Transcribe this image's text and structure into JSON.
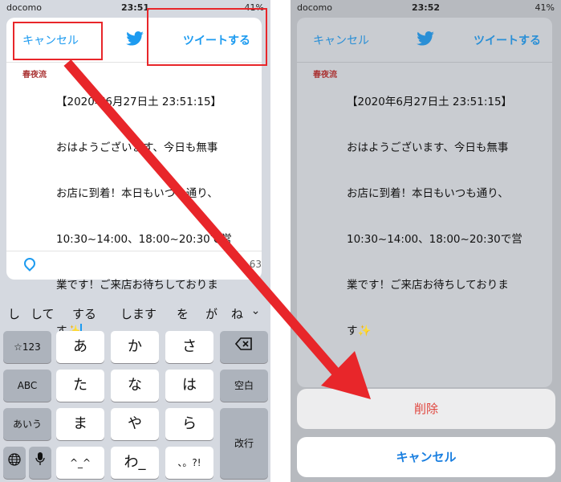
{
  "left": {
    "status": {
      "carrier": "docomo",
      "time": "23:51",
      "battery": "41%"
    },
    "header": {
      "cancel": "キャンセル",
      "tweet": "ツイートする"
    },
    "avatar_text": "春夜流",
    "tweet_lines": [
      "【2020年6月27日土 23:51:15】",
      "おはようございます、今日も無事",
      "お店に到着！本日もいつも通り、",
      "10:30~14:00、18:00~20:30で営",
      "業です！ご来店お待ちしておりま",
      "す✨"
    ],
    "char_count": "63",
    "suggestions": [
      "し",
      "して",
      "する",
      "します",
      "を",
      "が",
      "ね"
    ],
    "keys": {
      "sym": "☆123",
      "abc": "ABC",
      "aiu": "あいう",
      "a": "あ",
      "ka": "か",
      "sa": "さ",
      "ta": "た",
      "na": "な",
      "ha": "は",
      "ma": "ま",
      "ya": "や",
      "ra": "ら",
      "kao": "^_^",
      "wa": "わ_",
      "punct": "、。?!",
      "space": "空白",
      "enter": "改行"
    }
  },
  "right": {
    "status": {
      "carrier": "docomo",
      "time": "23:52",
      "battery": "41%"
    },
    "header": {
      "cancel": "キャンセル",
      "tweet": "ツイートする"
    },
    "avatar_text": "春夜流",
    "tweet_lines": [
      "【2020年6月27日土 23:51:15】",
      "おはようございます、今日も無事",
      "お店に到着！本日もいつも通り、",
      "10:30~14:00、18:00~20:30で営",
      "業です！ご来店お待ちしておりま",
      "す✨"
    ],
    "actions": {
      "delete": "削除",
      "cancel": "キャンセル"
    }
  },
  "colors": {
    "annotation": "#e8262a",
    "twitter_blue": "#1d9bf0",
    "delete_red": "#e0443c"
  },
  "icons": {
    "bird": "twitter-bird-icon",
    "location": "location-pin-icon",
    "backspace": "backspace-icon",
    "globe": "globe-icon",
    "mic": "microphone-icon",
    "chevron": "chevron-down-icon"
  }
}
